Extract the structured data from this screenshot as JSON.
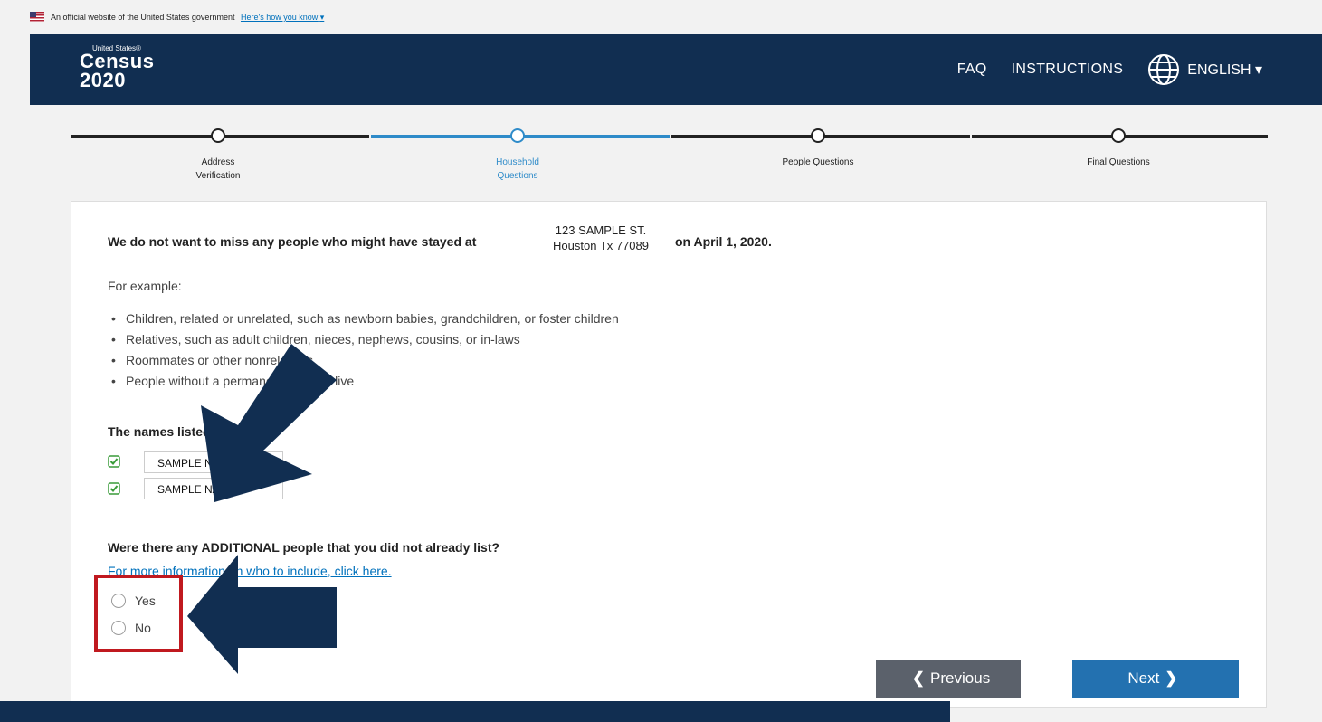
{
  "gov_banner": {
    "text": "An official website of the United States government",
    "link": "Here's how you know",
    "link_caret": "▾"
  },
  "header": {
    "logo_small": "United States®",
    "logo_line1": "Census",
    "logo_line2": "2020",
    "nav": [
      "FAQ",
      "INSTRUCTIONS"
    ],
    "language": "ENGLISH",
    "language_caret": "▾",
    "brand_color": "#112e51"
  },
  "progress": {
    "steps": [
      {
        "label_1": "Address",
        "label_2": "Verification",
        "active": false
      },
      {
        "label_1": "Household",
        "label_2": "Questions",
        "active": true
      },
      {
        "label_1": "People Questions",
        "label_2": "",
        "active": false
      },
      {
        "label_1": "Final Questions",
        "label_2": "",
        "active": false
      }
    ],
    "active_color": "#2e8bc9"
  },
  "form": {
    "intro": "We do not want to miss any people who might have stayed at",
    "address_line1": "123 SAMPLE ST.",
    "address_line2": "Houston Tx 77089",
    "date_text": "on April 1, 2020.",
    "for_example": "For example:",
    "examples": [
      "Children, related or unrelated, such as newborn babies, grandchildren, or foster children",
      "Relatives, such as adult children, nieces, nephews, cousins, or in-laws",
      "Roommates or other nonrelatives",
      "People without a permanent place to live"
    ],
    "names_title": "The names listed so far",
    "names": [
      "SAMPLE NAME",
      "SAMPLE NAME"
    ],
    "question": "Were there any ADDITIONAL people that you did not already list?",
    "more_info": "For more information on who to include, click here.",
    "options": [
      "Yes",
      "No"
    ]
  },
  "buttons": {
    "previous": "Previous",
    "previous_icon": "❮",
    "next": "Next",
    "next_icon": "❯"
  },
  "annotation_colors": {
    "arrow": "#112e51",
    "highlight": "#c0191f"
  }
}
